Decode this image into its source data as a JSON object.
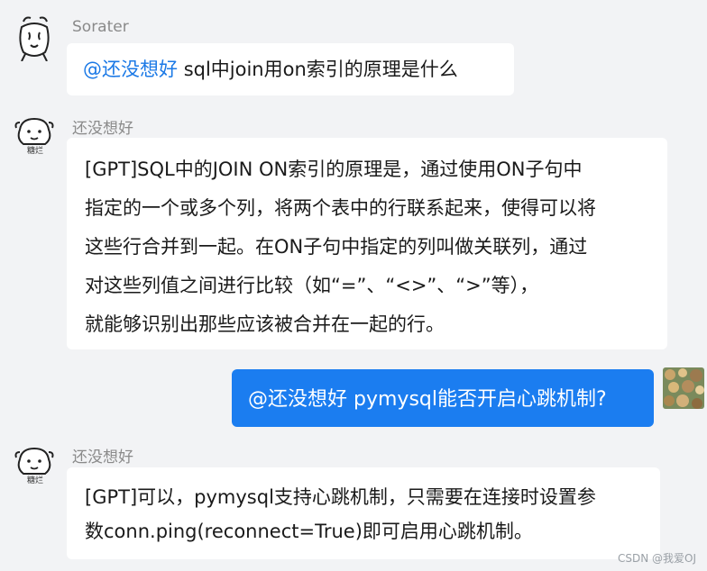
{
  "messages": [
    {
      "sender": "Sorater",
      "mention": "@还没想好",
      "text": "sql中join用on索引的原理是什么"
    },
    {
      "sender": "还没想好",
      "avatar_caption": "糖烂",
      "lines": [
        "[GPT]SQL中的JOIN ON索引的原理是，通过使用ON子句中",
        "指定的一个或多个列，将两个表中的行联系起来，使得可以将",
        "这些行合并到一起。在ON子句中指定的列叫做关联列，通过",
        "对这些列值之间进行比较（如“=”、“<>”、“>”等），",
        "就能够识别出那些应该被合并在一起的行。"
      ]
    },
    {
      "mention": "@还没想好",
      "text": "pymysql能否开启心跳机制?"
    },
    {
      "sender": "还没想好",
      "avatar_caption": "糖烂",
      "lines": [
        "[GPT]可以，pymysql支持心跳机制，只需要在连接时设置参",
        "数conn.ping(reconnect=True)即可启用心跳机制。"
      ]
    }
  ],
  "watermark": "CSDN @我爱OJ",
  "colors": {
    "background": "#f2f3f5",
    "bubble": "#ffffff",
    "sent_bubble": "#1b7df0",
    "mention": "#1b79e6"
  }
}
